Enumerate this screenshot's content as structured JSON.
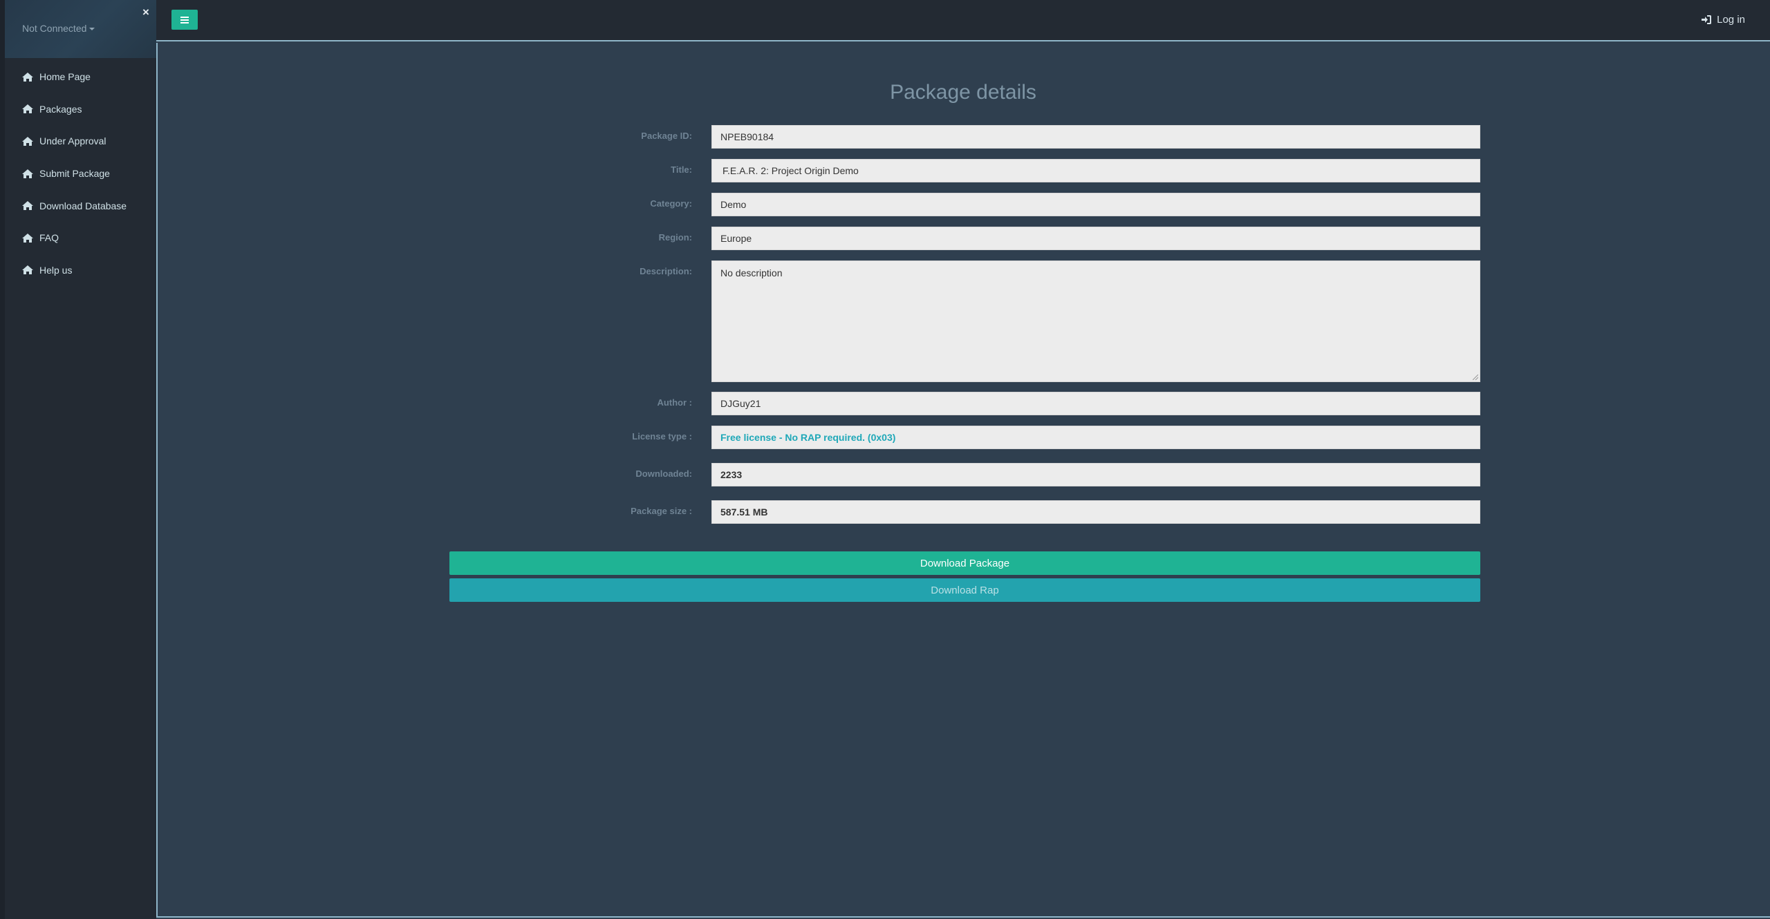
{
  "sidebar": {
    "user_status": "Not Connected",
    "close_symbol": "×",
    "items": [
      {
        "label": "Home Page",
        "icon": "home-icon"
      },
      {
        "label": "Packages",
        "icon": "home-icon"
      },
      {
        "label": "Under Approval",
        "icon": "home-icon"
      },
      {
        "label": "Submit Package",
        "icon": "home-icon"
      },
      {
        "label": "Download Database",
        "icon": "home-icon"
      },
      {
        "label": "FAQ",
        "icon": "home-icon"
      },
      {
        "label": "Help us",
        "icon": "home-icon"
      }
    ]
  },
  "topbar": {
    "menu_icon": "hamburger-icon",
    "login_label": "Log in",
    "login_icon": "sign-in-icon"
  },
  "page": {
    "title": "Package details"
  },
  "fields": {
    "package_id": {
      "label": "Package ID:",
      "value": "NPEB90184"
    },
    "title": {
      "label": "Title:",
      "value": "F.E.A.R. 2: Project Origin Demo"
    },
    "category": {
      "label": "Category:",
      "value": "Demo"
    },
    "region": {
      "label": "Region:",
      "value": "Europe"
    },
    "description": {
      "label": "Description:",
      "value": "No description"
    },
    "author": {
      "label": "Author :",
      "value": "DJGuy21"
    },
    "license_type": {
      "label": "License type :",
      "value": "Free license - No RAP required. (0x03)"
    },
    "downloaded": {
      "label": "Downloaded:",
      "value": "2233"
    },
    "package_size": {
      "label": "Package size :",
      "value": "587.51 MB"
    }
  },
  "actions": {
    "download_package": "Download Package",
    "download_rap": "Download Rap"
  },
  "colors": {
    "accent": "#1fb394",
    "secondary": "#23a3ae",
    "license_text": "#1fa8b8",
    "sidebar_bg": "#232a33",
    "main_bg": "#2f3f4f"
  }
}
